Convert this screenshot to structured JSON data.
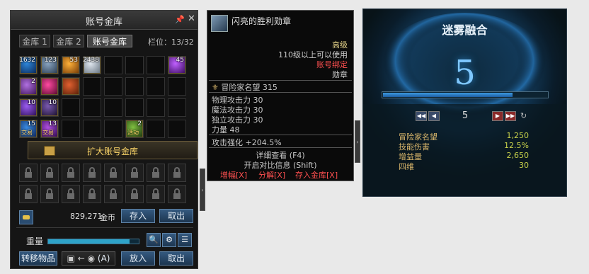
{
  "storage": {
    "title": "账号金库",
    "tabs": [
      "金库 1",
      "金库 2",
      "账号金库"
    ],
    "active_tab": 2,
    "slots_label": "栏位：13/32",
    "items": [
      {
        "row": 0,
        "col": 0,
        "count": "1632",
        "name": "item-blue-crystal-icon",
        "colors": [
          "#2e86d9",
          "#0b2a5a"
        ]
      },
      {
        "row": 0,
        "col": 1,
        "count": "123",
        "name": "item-chest-icon",
        "colors": [
          "#8aa4c0",
          "#2b3d52"
        ]
      },
      {
        "row": 0,
        "col": 2,
        "count": "53",
        "name": "item-gold-medal-icon",
        "colors": [
          "#ffb23a",
          "#7a3d07"
        ]
      },
      {
        "row": 0,
        "col": 3,
        "count": "2438",
        "name": "item-silver-gem-icon",
        "colors": [
          "#dfe6ee",
          "#6b7885"
        ]
      },
      {
        "row": 0,
        "col": 7,
        "count": "45",
        "name": "item-purple-orb-icon",
        "colors": [
          "#c060ff",
          "#3a0d60"
        ]
      },
      {
        "row": 1,
        "col": 0,
        "count": "2",
        "name": "item-scroll-icon",
        "colors": [
          "#b070e0",
          "#40165a"
        ]
      },
      {
        "row": 1,
        "col": 1,
        "count": "",
        "name": "item-red-orb-icon",
        "colors": [
          "#ff4aa0",
          "#5a0a30"
        ]
      },
      {
        "row": 1,
        "col": 2,
        "count": "",
        "name": "item-golden-frame-icon",
        "colors": [
          "#e06030",
          "#5a2008"
        ]
      },
      {
        "row": 2,
        "col": 0,
        "count": "10",
        "name": "item-purple-book-icon",
        "colors": [
          "#9a5cf0",
          "#2e0f5a"
        ]
      },
      {
        "row": 2,
        "col": 1,
        "count": "10",
        "name": "item-dark-orb-icon",
        "colors": [
          "#7a5ab0",
          "#1a102e"
        ]
      },
      {
        "row": 3,
        "col": 0,
        "count": "15",
        "name": "item-tradeable-crystal-icon",
        "colors": [
          "#3a8ae0",
          "#10285a"
        ],
        "trade": "交易"
      },
      {
        "row": 3,
        "col": 1,
        "count": "13",
        "name": "item-tradeable-purple-icon",
        "colors": [
          "#b050e0",
          "#300a50"
        ],
        "trade": "交易"
      },
      {
        "row": 3,
        "col": 5,
        "count": "2",
        "name": "item-potion-icon",
        "colors": [
          "#7fbf40",
          "#1f3a10"
        ],
        "trade": "活动"
      }
    ],
    "expand_label": "扩大账号金库",
    "gold_amount": "829,271",
    "gold_unit": "金币",
    "deposit_label": "存入",
    "withdraw_label": "取出",
    "weight_label": "重量",
    "weight_fraction": 0.9,
    "transfer_label": "转移物品",
    "transfer_hint": "(A)",
    "put_label": "放入",
    "take_label": "取出"
  },
  "tooltip": {
    "name": "闪亮的胜利勋章",
    "grade": "高级",
    "level_req": "110级以上可以使用",
    "bind": "账号绑定",
    "type": "勋章",
    "fame_label": "冒险家名望",
    "fame_value": "315",
    "stats": [
      "物理攻击力 30",
      "魔法攻击力 30",
      "独立攻击力 30",
      "力量 48"
    ],
    "attack_boost_label": "攻击强化",
    "attack_boost_value": "+204.5%",
    "detail": "详细查看 (F4)",
    "compare": "开启对比信息 (Shift)",
    "actions": [
      "增幅[X]",
      "分解[X]",
      "存入金库[X]"
    ],
    "colors": {
      "grade": "#e6d48a",
      "bind": "#ff5050",
      "action": "#ff5050",
      "text": "#c8c8c8"
    }
  },
  "fusion": {
    "title": "迷雾融合",
    "level": "5",
    "progress": 0.79,
    "current": "5",
    "stats": [
      {
        "label": "冒险家名望",
        "value": "1,250"
      },
      {
        "label": "技能伤害",
        "value": "12.5%"
      },
      {
        "label": "增益量",
        "value": "2,650"
      },
      {
        "label": "四维",
        "value": "30"
      }
    ]
  }
}
